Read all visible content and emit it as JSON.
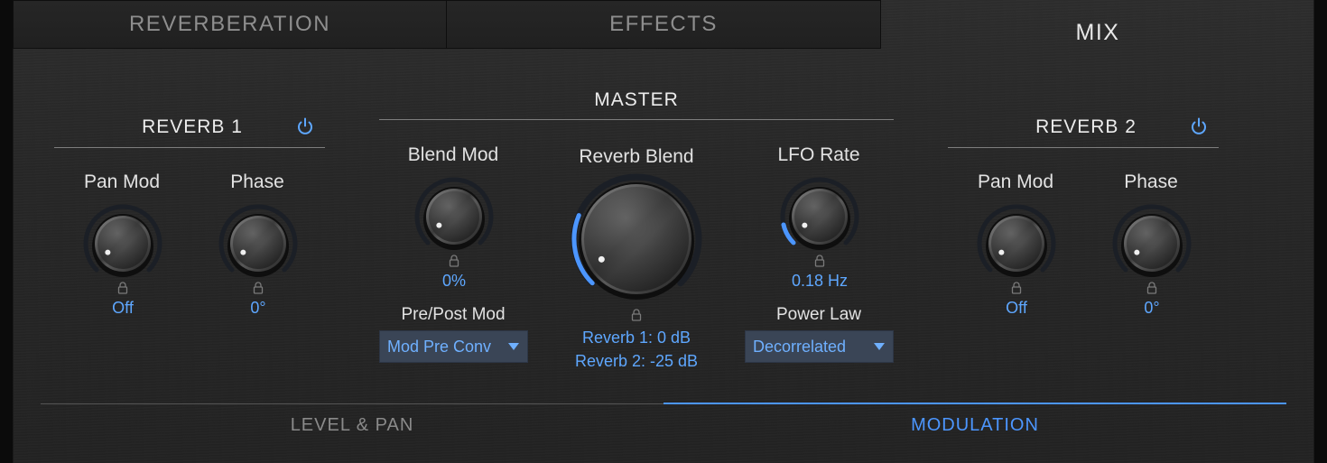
{
  "tabs": {
    "reverberation": "REVERBERATION",
    "effects": "EFFECTS",
    "mix": "MIX"
  },
  "reverb1": {
    "title": "REVERB 1",
    "pan_mod": {
      "label": "Pan Mod",
      "value": "Off"
    },
    "phase": {
      "label": "Phase",
      "value": "0°"
    }
  },
  "master": {
    "title": "MASTER",
    "blend_mod": {
      "label": "Blend Mod",
      "value": "0%"
    },
    "reverb_blend": {
      "label": "Reverb Blend",
      "value_line1": "Reverb 1: 0 dB",
      "value_line2": "Reverb 2: -25 dB",
      "level": 0.25
    },
    "lfo_rate": {
      "label": "LFO Rate",
      "value": "0.18 Hz"
    },
    "pre_post_mod": {
      "label": "Pre/Post Mod",
      "selected": "Mod Pre Conv"
    },
    "power_law": {
      "label": "Power Law",
      "selected": "Decorrelated"
    }
  },
  "reverb2": {
    "title": "REVERB 2",
    "pan_mod": {
      "label": "Pan Mod",
      "value": "Off"
    },
    "phase": {
      "label": "Phase",
      "value": "0°"
    }
  },
  "bottom_tabs": {
    "level_pan": "LEVEL & PAN",
    "modulation": "MODULATION"
  },
  "colors": {
    "accent": "#4c96ff",
    "value_text": "#5ea7ff",
    "dropdown_bg": "#3a4556"
  }
}
